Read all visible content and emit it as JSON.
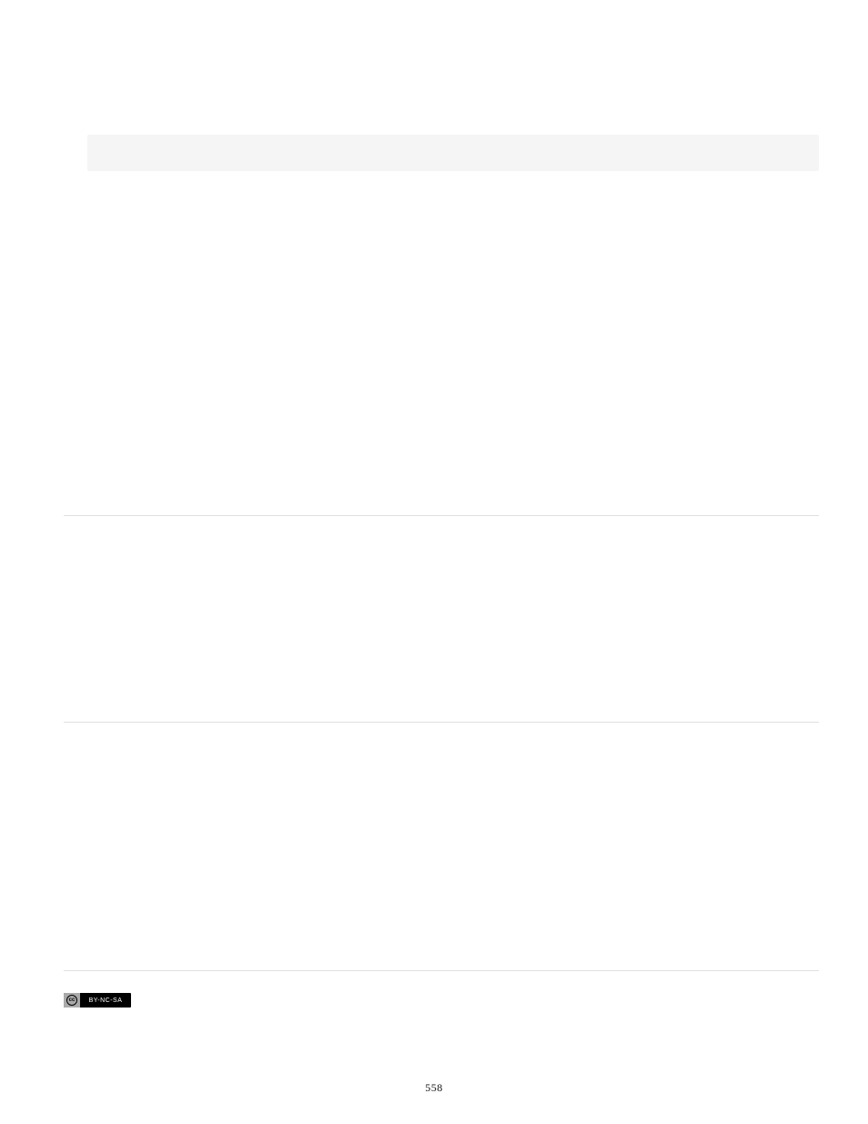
{
  "page": {
    "number": "558"
  },
  "license": {
    "badge_cc_text": "cc",
    "badge_terms_text": "BY-NC-SA"
  }
}
